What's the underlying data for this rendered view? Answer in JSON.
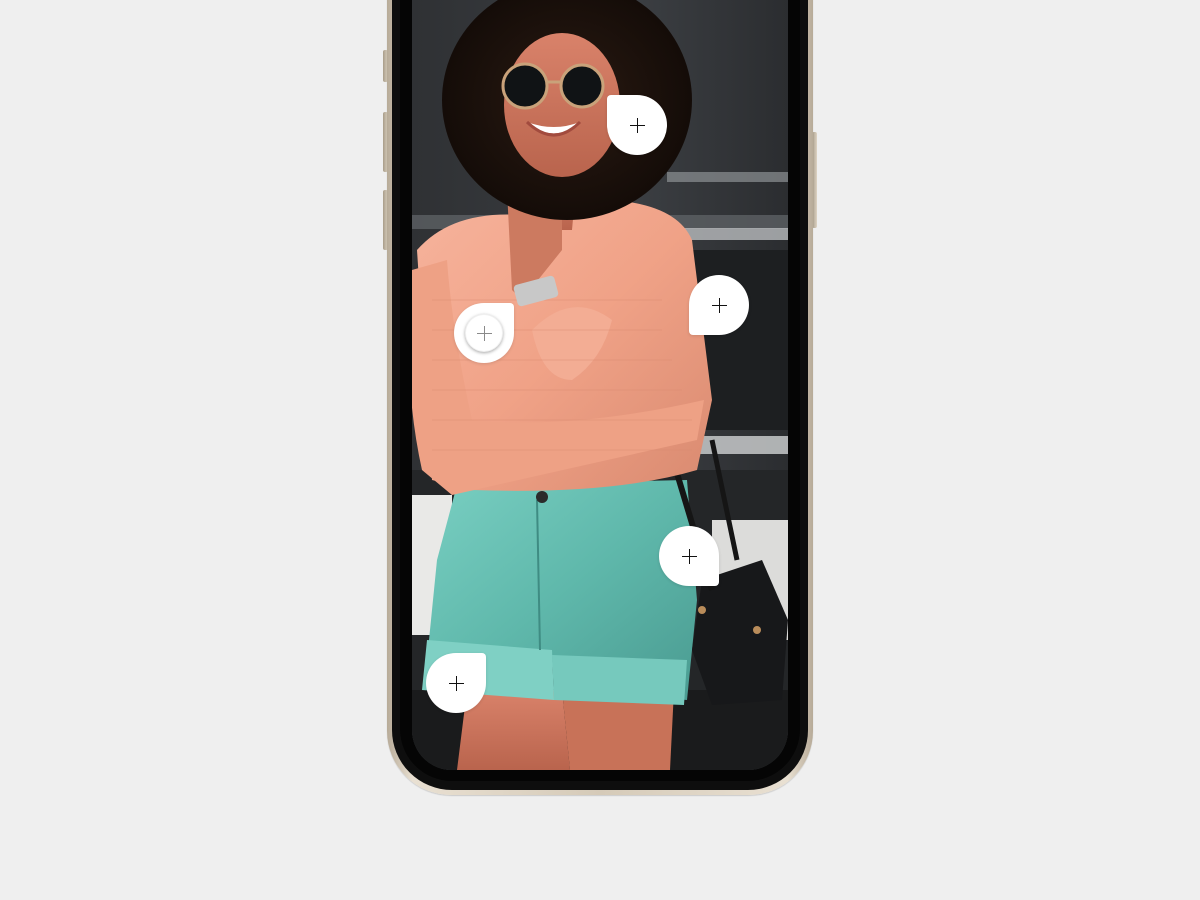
{
  "scene": {
    "background": "#efefef",
    "photo_description_hidden": ""
  },
  "tags": [
    {
      "name": "tag-sunglasses",
      "icon": "plus-icon",
      "active": false
    },
    {
      "name": "tag-bag-strap",
      "icon": "plus-icon",
      "active": false
    },
    {
      "name": "tag-sweater",
      "icon": "plus-icon",
      "active": true
    },
    {
      "name": "tag-handbag",
      "icon": "plus-icon",
      "active": false
    },
    {
      "name": "tag-shorts",
      "icon": "plus-icon",
      "active": false
    }
  ],
  "colors": {
    "phone_frame": "#d5cab8",
    "sweater": "#f0a58a",
    "shorts": "#6fc2b6",
    "tag_bubble": "#ffffff"
  }
}
